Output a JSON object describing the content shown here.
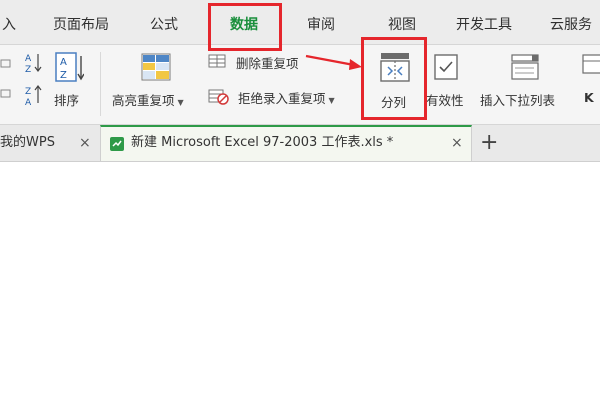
{
  "menu": {
    "tabs": [
      {
        "label": "入",
        "active": false
      },
      {
        "label": "页面布局",
        "active": false
      },
      {
        "label": "公式",
        "active": false
      },
      {
        "label": "数据",
        "active": true
      },
      {
        "label": "审阅",
        "active": false
      },
      {
        "label": "视图",
        "active": false
      },
      {
        "label": "开发工具",
        "active": false
      },
      {
        "label": "云服务",
        "active": false
      }
    ]
  },
  "ribbon": {
    "sort_label": "排序",
    "highlight_dup_label": "高亮重复项",
    "remove_dup_label": "删除重复项",
    "reject_dup_label": "拒绝录入重复项",
    "split_label": "分列",
    "validity_label": "有效性",
    "dropdown_list_label": "插入下拉列表",
    "partial_k": "K"
  },
  "doctabs": {
    "tab1_label": "我的WPS",
    "tab2_label": "新建 Microsoft Excel 97-2003 工作表.xls *",
    "add_symbol": "+",
    "close_symbol": "×"
  },
  "colors": {
    "highlight_red": "#e5262c",
    "active_green": "#1a8f3c"
  }
}
